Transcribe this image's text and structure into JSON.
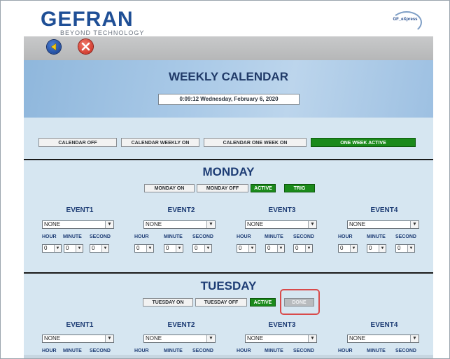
{
  "header": {
    "logo": "GEFRAN",
    "tagline": "BEYOND TECHNOLOGY",
    "badge": "GF_eXpress",
    "back_icon": "back-arrow-icon",
    "close_icon": "close-x-icon"
  },
  "banner": {
    "title": "WEEKLY CALENDAR",
    "clock": "0:09:12  Wednesday, February 6, 2020"
  },
  "modes": {
    "off": "CALENDAR OFF",
    "weekly_on": "CALENDAR WEEKLY ON",
    "one_week_on": "CALENDAR ONE WEEK ON",
    "status": "ONE WEEK ACTIVE"
  },
  "monday": {
    "title": "MONDAY",
    "on": "MONDAY ON",
    "off": "MONDAY OFF",
    "active": "ACTIVE",
    "trig": "TRIG",
    "events": [
      {
        "title": "EVENT1",
        "value": "NONE",
        "hour_label": "HOUR",
        "minute_label": "MINUTE",
        "second_label": "SECOND",
        "hour": "0",
        "minute": "0",
        "second": "0"
      },
      {
        "title": "EVENT2",
        "value": "NONE",
        "hour_label": "HOUR",
        "minute_label": "MINUTE",
        "second_label": "SECOND",
        "hour": "0",
        "minute": "0",
        "second": "0"
      },
      {
        "title": "EVENT3",
        "value": "NONE",
        "hour_label": "HOUR",
        "minute_label": "MINUTE",
        "second_label": "SECOND",
        "hour": "0",
        "minute": "0",
        "second": "0"
      },
      {
        "title": "EVENT4",
        "value": "NONE",
        "hour_label": "HOUR",
        "minute_label": "MINUTE",
        "second_label": "SECOND",
        "hour": "0",
        "minute": "0",
        "second": "0"
      }
    ]
  },
  "tuesday": {
    "title": "TUESDAY",
    "on": "TUESDAY ON",
    "off": "TUESDAY OFF",
    "active": "ACTIVE",
    "done": "DONE",
    "events": [
      {
        "title": "EVENT1",
        "value": "NONE",
        "hour_label": "HOUR",
        "minute_label": "MINUTE",
        "second_label": "SECOND"
      },
      {
        "title": "EVENT2",
        "value": "NONE",
        "hour_label": "HOUR",
        "minute_label": "MINUTE",
        "second_label": "SECOND"
      },
      {
        "title": "EVENT3",
        "value": "NONE",
        "hour_label": "HOUR",
        "minute_label": "MINUTE",
        "second_label": "SECOND"
      },
      {
        "title": "EVENT4",
        "value": "NONE",
        "hour_label": "HOUR",
        "minute_label": "MINUTE",
        "second_label": "SECOND"
      }
    ]
  },
  "colors": {
    "brand": "#1f4f96",
    "active_green": "#1b8a1b",
    "highlight": "#d94a4a"
  }
}
